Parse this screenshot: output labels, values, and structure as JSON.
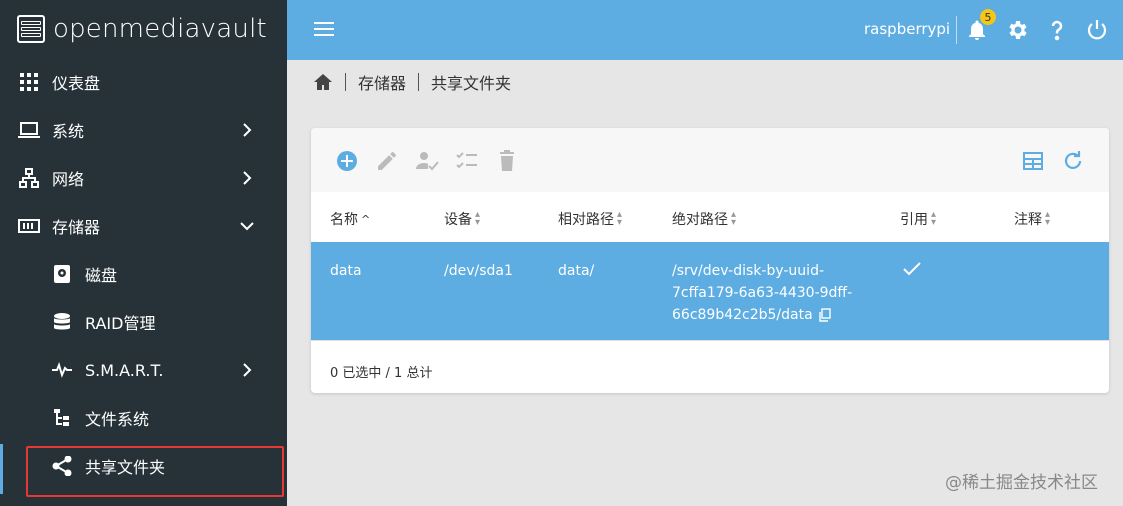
{
  "brand": {
    "name": "openmediavault"
  },
  "sidebar": {
    "items": [
      {
        "label": "仪表盘",
        "icon": "dashboard-grid-icon"
      },
      {
        "label": "系统",
        "icon": "laptop-icon"
      },
      {
        "label": "网络",
        "icon": "network-icon"
      },
      {
        "label": "存储器",
        "icon": "storage-icon"
      },
      {
        "label": "磁盘",
        "icon": "disk-icon"
      },
      {
        "label": "RAID管理",
        "icon": "database-icon"
      },
      {
        "label": "S.M.A.R.T.",
        "icon": "pulse-icon"
      },
      {
        "label": "文件系统",
        "icon": "file-tree-icon"
      },
      {
        "label": "共享文件夹",
        "icon": "share-icon"
      }
    ]
  },
  "header": {
    "hostname": "raspberrypi",
    "notification_count": "5"
  },
  "breadcrumb": {
    "items": [
      "存储器",
      "共享文件夹"
    ]
  },
  "table": {
    "columns": [
      "名称",
      "设备",
      "相对路径",
      "绝对路径",
      "引用",
      "注释"
    ],
    "rows": [
      {
        "name": "data",
        "device": "/dev/sda1",
        "relpath": "data/",
        "abspath_lines": [
          "/srv/dev-disk-by-uuid-",
          "7cffa179-6a63-4430-9dff-",
          "66c89b42c2b5/data"
        ]
      }
    ],
    "footer": "0 已选中 / 1 总计"
  },
  "watermark": "@稀土掘金技术社区",
  "colors": {
    "sidebar": "#263238",
    "accent": "#5dade2",
    "highlight": "#e53935",
    "badge": "#f5c518"
  }
}
